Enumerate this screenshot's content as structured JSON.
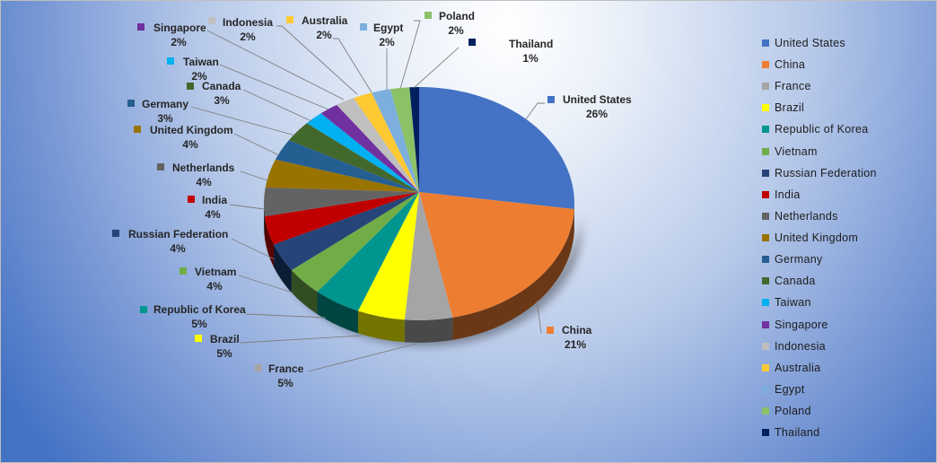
{
  "chart_data": {
    "type": "pie",
    "style": "3d",
    "title": "",
    "categories": [
      "United States",
      "China",
      "France",
      "Brazil",
      "Republic of Korea",
      "Vietnam",
      "Russian Federation",
      "India",
      "Netherlands",
      "United Kingdom",
      "Germany",
      "Canada",
      "Taiwan",
      "Singapore",
      "Indonesia",
      "Australia",
      "Egypt",
      "Poland",
      "Thailand"
    ],
    "values": [
      26,
      21,
      5,
      5,
      5,
      4,
      4,
      4,
      4,
      4,
      3,
      3,
      2,
      2,
      2,
      2,
      2,
      2,
      1
    ],
    "value_labels": [
      "26%",
      "21%",
      "5%",
      "5%",
      "5%",
      "4%",
      "4%",
      "4%",
      "4%",
      "4%",
      "3%",
      "3%",
      "2%",
      "2%",
      "2%",
      "2%",
      "2%",
      "2%",
      "1%"
    ],
    "colors": [
      "#4472c4",
      "#ed7d31",
      "#a5a5a5",
      "#ffff00",
      "#00968f",
      "#70ad47",
      "#264478",
      "#c00000",
      "#636363",
      "#997300",
      "#255e91",
      "#43682b",
      "#00b0f0",
      "#7030a0",
      "#bfbfbf",
      "#ffc933",
      "#7cafdd",
      "#8cc168",
      "#002060"
    ],
    "unit": "percent",
    "legend": {
      "position": "right"
    }
  }
}
